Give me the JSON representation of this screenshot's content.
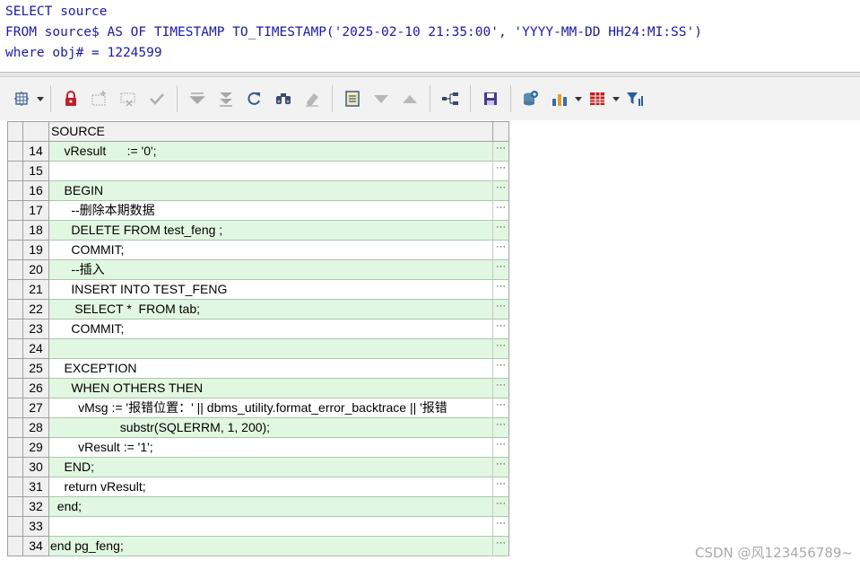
{
  "editor": {
    "line1": "SELECT source",
    "line2": "FROM source$ AS OF TIMESTAMP TO_TIMESTAMP('2025-02-10 21:35:00', 'YYYY-MM-DD HH24:MI:SS')",
    "line3": "where obj# = 1224599"
  },
  "toolbar": {
    "icons": [
      "grid-menu-icon",
      "lock-icon",
      "insert-record-icon",
      "delete-record-icon",
      "post-changes-icon",
      "first-record-icon",
      "last-record-icon",
      "refresh-icon",
      "find-icon",
      "clear-icon",
      "single-record-view-icon",
      "next-page-icon",
      "previous-page-icon",
      "query-tree-icon",
      "save-icon",
      "export-icon",
      "chart-icon",
      "table-view-icon",
      "filter-icon"
    ]
  },
  "grid": {
    "column_header": "SOURCE",
    "row_button": "···",
    "rows": [
      {
        "num": "14",
        "text": "    vResult      := '0';"
      },
      {
        "num": "15",
        "text": ""
      },
      {
        "num": "16",
        "text": "    BEGIN"
      },
      {
        "num": "17",
        "text": "      --删除本期数据"
      },
      {
        "num": "18",
        "text": "      DELETE FROM test_feng ;"
      },
      {
        "num": "19",
        "text": "      COMMIT;"
      },
      {
        "num": "20",
        "text": "      --插入"
      },
      {
        "num": "21",
        "text": "      INSERT INTO TEST_FENG"
      },
      {
        "num": "22",
        "text": "       SELECT *  FROM tab;"
      },
      {
        "num": "23",
        "text": "      COMMIT;"
      },
      {
        "num": "24",
        "text": ""
      },
      {
        "num": "25",
        "text": "    EXCEPTION"
      },
      {
        "num": "26",
        "text": "      WHEN OTHERS THEN"
      },
      {
        "num": "27",
        "text": "        vMsg := '报错位置：' || dbms_utility.format_error_backtrace || '报错"
      },
      {
        "num": "28",
        "text": "                    substr(SQLERRM, 1, 200);"
      },
      {
        "num": "29",
        "text": "        vResult := '1';"
      },
      {
        "num": "30",
        "text": "    END;"
      },
      {
        "num": "31",
        "text": "    return vResult;"
      },
      {
        "num": "32",
        "text": "  end;"
      },
      {
        "num": "33",
        "text": ""
      },
      {
        "num": "34",
        "text": "end pg_feng;"
      }
    ]
  },
  "watermark": "CSDN @风123456789~",
  "colors": {
    "row_green": "#e2f7e2",
    "sql_text": "#1a1aa6"
  }
}
